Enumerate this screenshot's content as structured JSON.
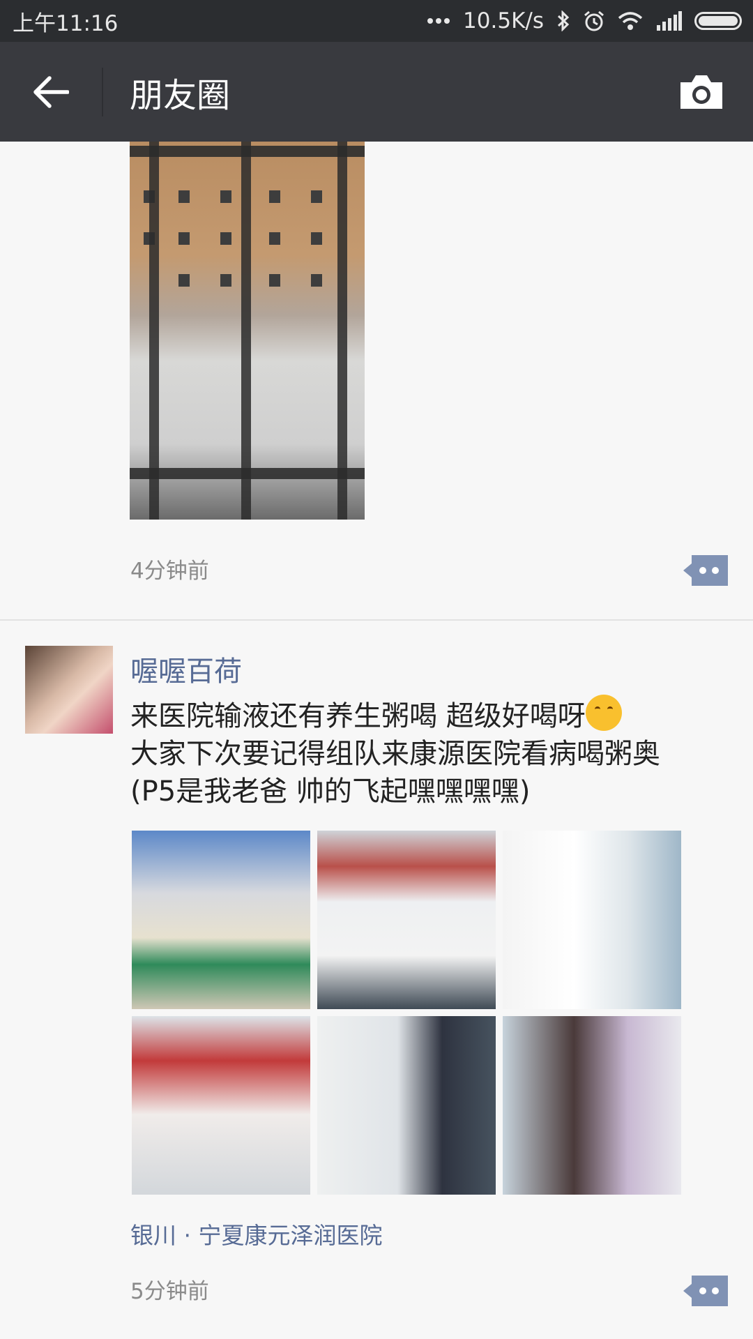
{
  "status_bar": {
    "time": "上午11:16",
    "network_speed": "10.5K/s",
    "icons": [
      "more-dots-icon",
      "bluetooth-icon",
      "alarm-icon",
      "wifi-icon",
      "signal-icon",
      "battery-icon"
    ]
  },
  "header": {
    "title": "朋友圈",
    "icons": [
      "back-arrow-icon",
      "camera-icon"
    ]
  },
  "posts": [
    {
      "time": "4分钟前",
      "images": [
        "snowy courtyard through window bars"
      ]
    },
    {
      "username": "喔喔百荷",
      "text_line1": "来医院输液还有养生粥喝   超级好喝呀",
      "text_line2": "大家下次要记得组队来康源医院看病喝粥奥",
      "text_line3": "(P5是我老爸   帅的飞起嘿嘿嘿嘿)",
      "emoji": "hug-emoji",
      "location": "银川 · 宁夏康元泽润医院",
      "time": "5分钟前"
    }
  ],
  "colors": {
    "title_bar": "#393a3f",
    "status_bar": "#2b2d30",
    "link": "#576b95",
    "background": "#f7f7f7"
  }
}
